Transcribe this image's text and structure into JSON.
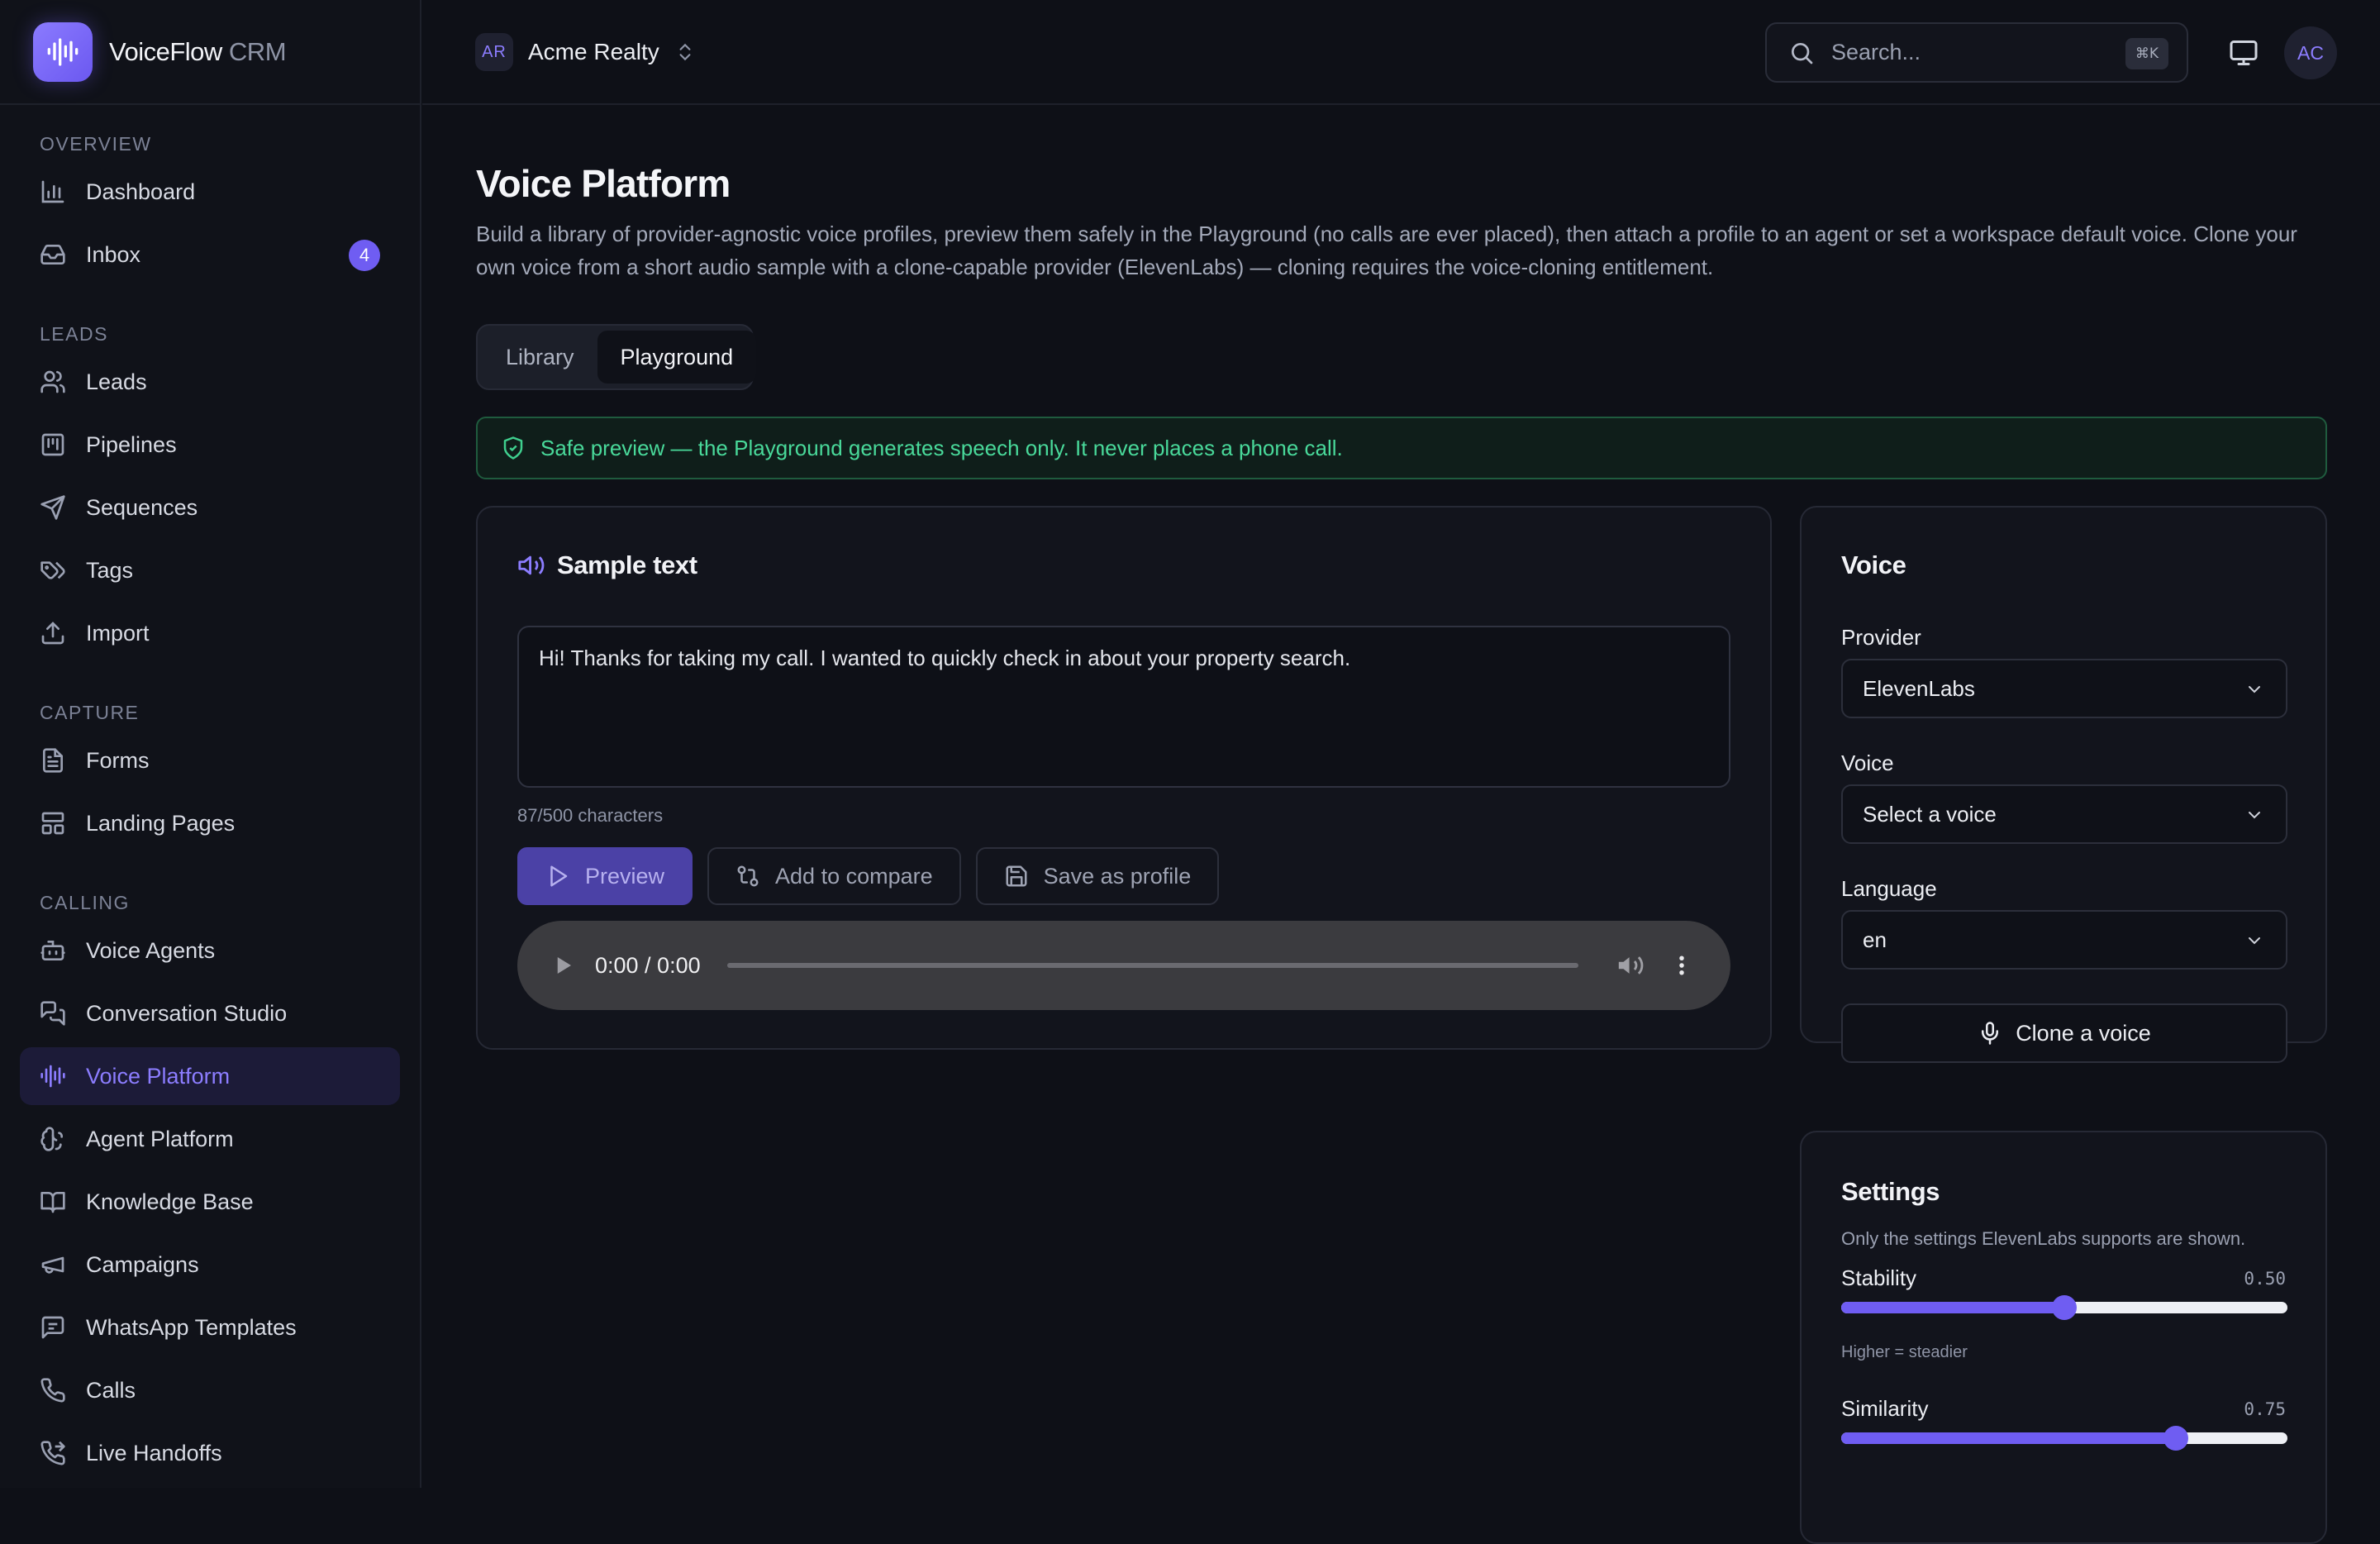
{
  "brand": {
    "name": "VoiceFlow",
    "suffix": "CRM"
  },
  "sidebar": {
    "sections": [
      {
        "label": "OVERVIEW",
        "items": [
          {
            "label": "Dashboard",
            "icon": "bar-chart-icon"
          },
          {
            "label": "Inbox",
            "icon": "inbox-icon",
            "badge": "4"
          }
        ]
      },
      {
        "label": "LEADS",
        "items": [
          {
            "label": "Leads",
            "icon": "users-icon"
          },
          {
            "label": "Pipelines",
            "icon": "kanban-icon"
          },
          {
            "label": "Sequences",
            "icon": "send-icon"
          },
          {
            "label": "Tags",
            "icon": "tags-icon"
          },
          {
            "label": "Import",
            "icon": "upload-icon"
          }
        ]
      },
      {
        "label": "CAPTURE",
        "items": [
          {
            "label": "Forms",
            "icon": "file-text-icon"
          },
          {
            "label": "Landing Pages",
            "icon": "layout-icon"
          }
        ]
      },
      {
        "label": "CALLING",
        "items": [
          {
            "label": "Voice Agents",
            "icon": "bot-icon"
          },
          {
            "label": "Conversation Studio",
            "icon": "messages-icon"
          },
          {
            "label": "Voice Platform",
            "icon": "audio-lines-icon",
            "active": true
          },
          {
            "label": "Agent Platform",
            "icon": "brain-icon"
          },
          {
            "label": "Knowledge Base",
            "icon": "book-icon"
          },
          {
            "label": "Campaigns",
            "icon": "megaphone-icon"
          },
          {
            "label": "WhatsApp Templates",
            "icon": "message-square-icon"
          },
          {
            "label": "Calls",
            "icon": "phone-icon"
          },
          {
            "label": "Live Handoffs",
            "icon": "phone-forward-icon"
          }
        ]
      }
    ]
  },
  "topbar": {
    "workspace": {
      "initials": "AR",
      "name": "Acme Realty"
    },
    "search": {
      "placeholder": "Search...",
      "shortcut": "⌘K"
    },
    "user_initials": "AC"
  },
  "page": {
    "title": "Voice Platform",
    "description": "Build a library of provider-agnostic voice profiles, preview them safely in the Playground (no calls are ever placed), then attach a profile to an agent or set a workspace default voice. Clone your own voice from a short audio sample with a clone-capable provider (ElevenLabs) — cloning requires the voice-cloning entitlement.",
    "tabs": [
      {
        "label": "Library"
      },
      {
        "label": "Playground",
        "active": true
      }
    ],
    "notice": "Safe preview — the Playground generates speech only. It never places a phone call."
  },
  "sample": {
    "title": "Sample text",
    "text": "Hi! Thanks for taking my call. I wanted to quickly check in about your property search.",
    "char_count": "87/500 characters",
    "preview_label": "Preview",
    "compare_label": "Add to compare",
    "save_label": "Save as profile",
    "audio_time": "0:00 / 0:00"
  },
  "voice": {
    "title": "Voice",
    "provider_label": "Provider",
    "provider_value": "ElevenLabs",
    "voice_label": "Voice",
    "voice_value": "Select a voice",
    "language_label": "Language",
    "language_value": "en",
    "clone_label": "Clone a voice"
  },
  "settings": {
    "title": "Settings",
    "subtitle": "Only the settings ElevenLabs supports are shown.",
    "stability": {
      "label": "Stability",
      "value": 0.5,
      "display": "0.50",
      "hint": "Higher = steadier"
    },
    "similarity": {
      "label": "Similarity",
      "value": 0.75,
      "display": "0.75"
    }
  },
  "colors": {
    "accent": "#6f5df2",
    "success": "#49d99a",
    "background": "#0e1017"
  }
}
